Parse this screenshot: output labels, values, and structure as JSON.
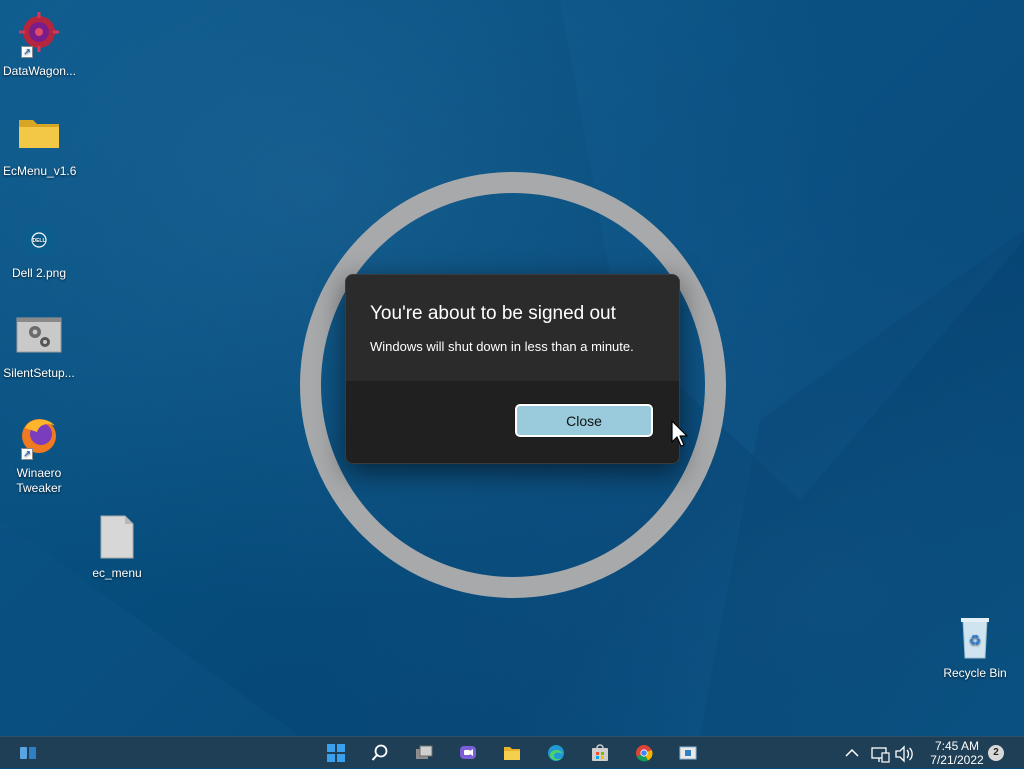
{
  "desktop": {
    "icons": [
      {
        "label": "DataWagon...",
        "icon": "datawagon-app-icon",
        "shortcut": true
      },
      {
        "label": "EcMenu_v1.6",
        "icon": "folder-icon",
        "shortcut": false
      },
      {
        "label": "Dell 2.png",
        "icon": "dell-logo-image-icon",
        "shortcut": false
      },
      {
        "label": "SilentSetup...",
        "icon": "settings-gears-icon",
        "shortcut": false
      },
      {
        "label": "Winaero\nTweaker",
        "label_line1": "Winaero",
        "label_line2": "Tweaker",
        "icon": "firefox-logo-icon",
        "shortcut": true
      },
      {
        "label": "ec_menu",
        "icon": "blank-file-icon",
        "shortcut": false
      },
      {
        "label": "Recycle Bin",
        "icon": "recycle-bin-icon",
        "shortcut": false
      }
    ]
  },
  "dialog": {
    "title": "You're about to be signed out",
    "message": "Windows will shut down in less than a minute.",
    "close_label": "Close"
  },
  "taskbar": {
    "items": [
      {
        "name": "widgets-icon"
      },
      {
        "name": "start-icon"
      },
      {
        "name": "search-icon"
      },
      {
        "name": "task-view-icon"
      },
      {
        "name": "chat-icon"
      },
      {
        "name": "file-explorer-icon"
      },
      {
        "name": "edge-icon"
      },
      {
        "name": "store-icon"
      },
      {
        "name": "chrome-icon"
      },
      {
        "name": "app-window-icon"
      }
    ],
    "clock": {
      "time": "7:45 AM",
      "date": "7/21/2022"
    },
    "notifications_count": "2"
  },
  "colors": {
    "desktop_bg": "#064d7c",
    "ring": "#a7a9ab",
    "dialog_body": "#2b2b2b",
    "dialog_footer": "#202020",
    "button_accent": "#99cbdc",
    "taskbar_bg": "#1f3f56"
  }
}
